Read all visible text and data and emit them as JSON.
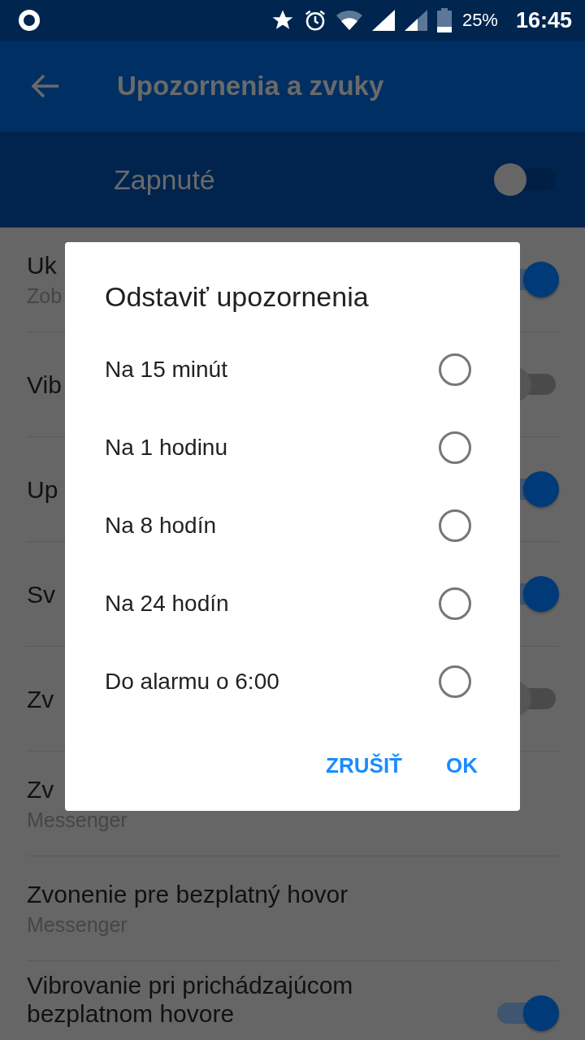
{
  "status_bar": {
    "battery": "25%",
    "time": "16:45"
  },
  "app_bar": {
    "title": "Upozornenia a zvuky"
  },
  "master_switch": {
    "label": "Zapnuté",
    "on": false
  },
  "settings": [
    {
      "kind": "switch",
      "title": "Uk",
      "subtitle": "Zob",
      "on": true
    },
    {
      "kind": "switch",
      "title": "Vib",
      "on": false
    },
    {
      "kind": "switch",
      "title": "Up",
      "on": true
    },
    {
      "kind": "switch",
      "title": "Sv",
      "on": true
    },
    {
      "kind": "switch",
      "title": "Zv",
      "on": false
    },
    {
      "kind": "plain",
      "title": "Zv",
      "subtitle": "Messenger"
    },
    {
      "kind": "plain",
      "title": "Zvonenie pre bezplatný hovor",
      "subtitle": "Messenger"
    },
    {
      "kind": "switch",
      "title": "Vibrovanie pri prichádzajúcom bezplatnom hovore",
      "on": true
    }
  ],
  "dialog": {
    "title": "Odstaviť upozornenia",
    "options": [
      {
        "label": "Na 15 minút",
        "selected": false
      },
      {
        "label": "Na 1 hodinu",
        "selected": false
      },
      {
        "label": "Na 8 hodín",
        "selected": false
      },
      {
        "label": "Na 24 hodín",
        "selected": false
      },
      {
        "label": "Do alarmu o 6:00",
        "selected": false
      }
    ],
    "buttons": [
      "ZRUŠIŤ",
      "OK"
    ]
  }
}
